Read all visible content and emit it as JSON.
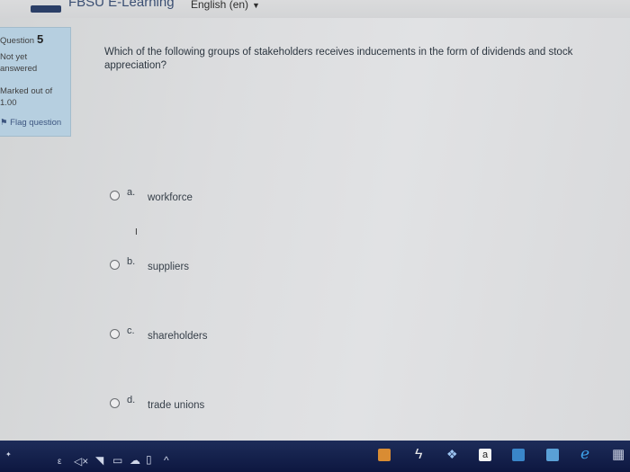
{
  "header": {
    "site_name": "FBSU E-Learning",
    "language": "English (en)"
  },
  "question_info": {
    "question_label": "Question",
    "question_number": "5",
    "state": "Not yet answered",
    "marked": "Marked out of 1.00",
    "flag": "Flag question"
  },
  "question": {
    "text": "Which of the following groups of stakeholders receives inducements in the form of dividends and stock appreciation?",
    "answers": [
      {
        "letter": "a.",
        "label": "workforce"
      },
      {
        "letter": "b.",
        "label": "suppliers"
      },
      {
        "letter": "c.",
        "label": "shareholders"
      },
      {
        "letter": "d.",
        "label": "trade unions"
      }
    ]
  },
  "taskbar": {
    "lang_indicator": "ε",
    "store_label": "a"
  }
}
